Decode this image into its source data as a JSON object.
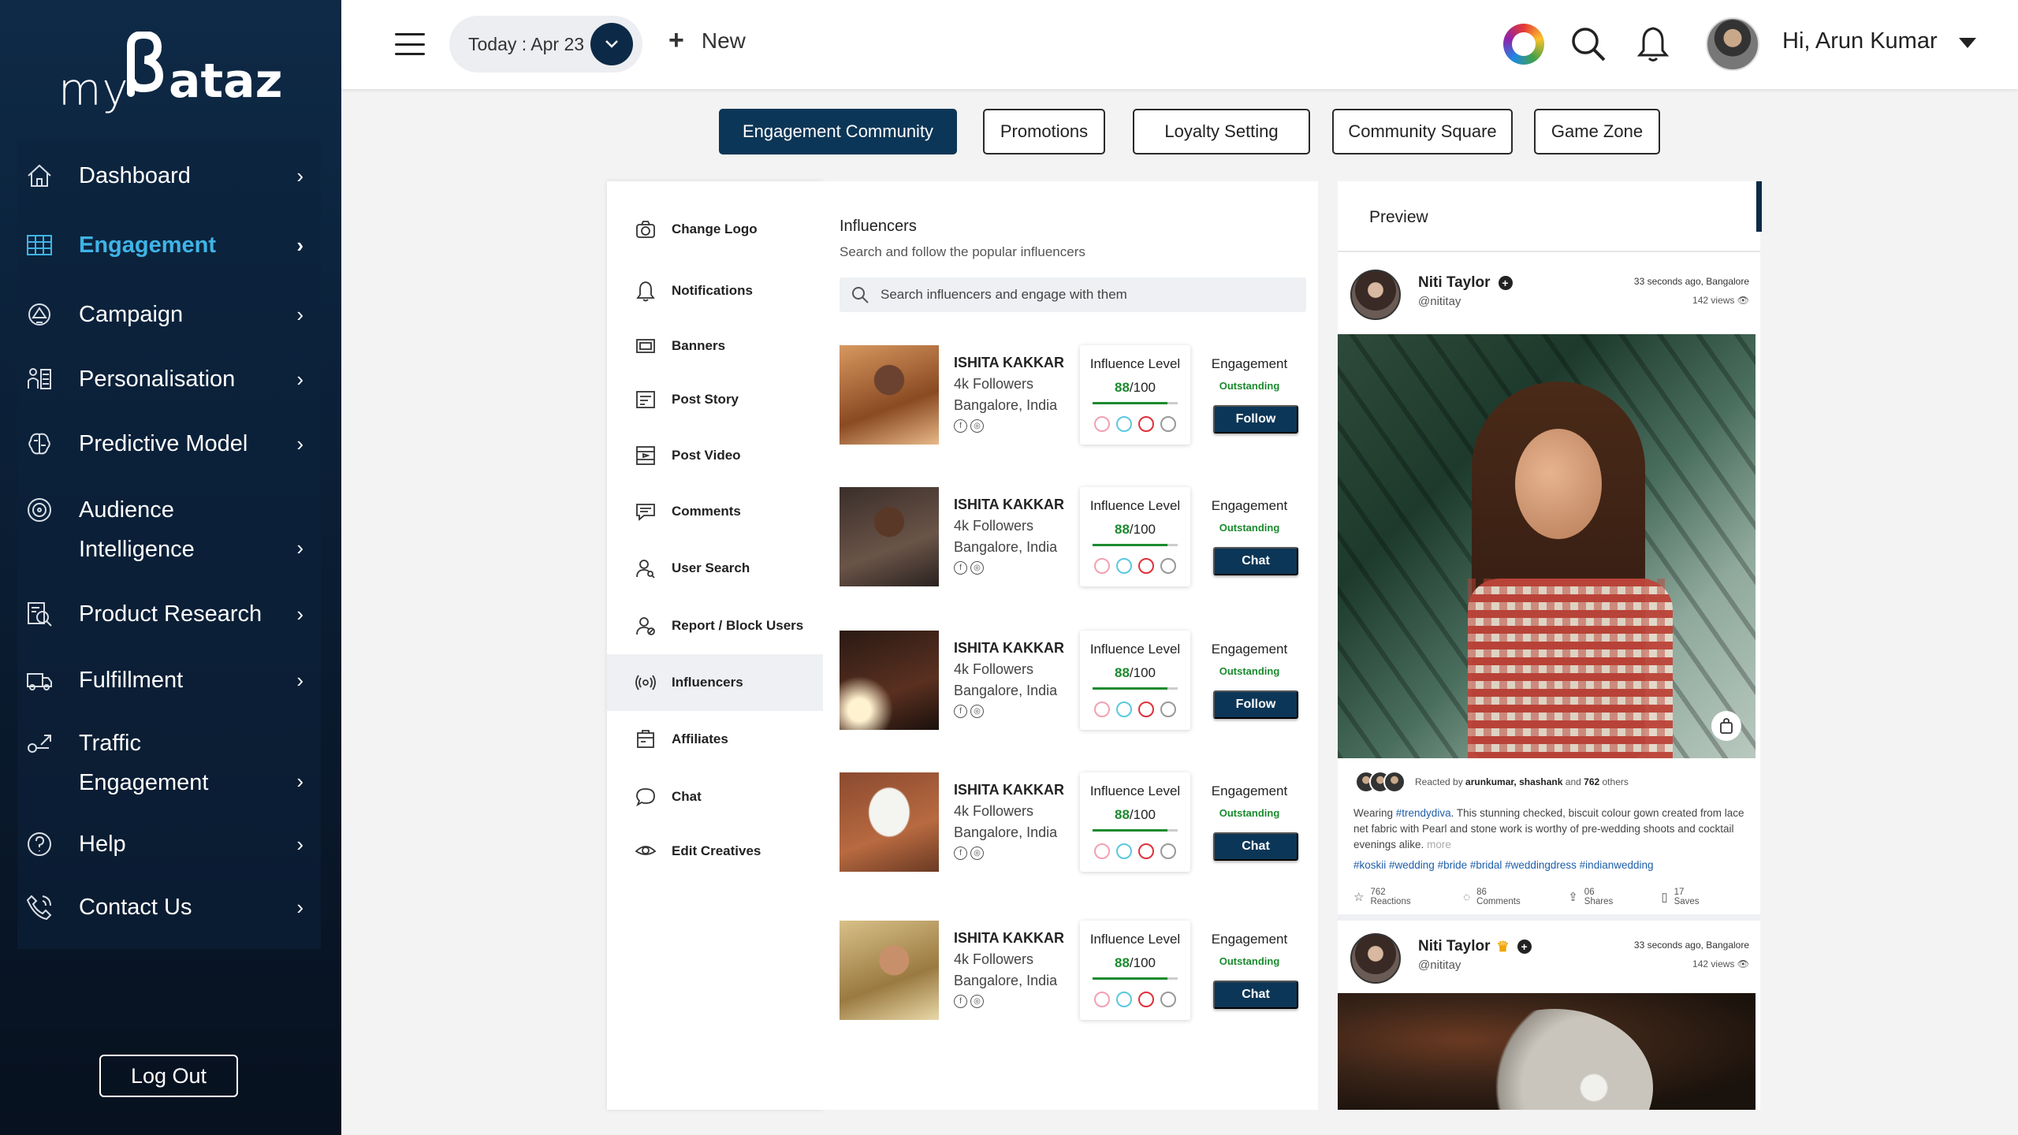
{
  "brand": {
    "logo_my": "my",
    "logo_ataz": "ataz"
  },
  "sidebar": {
    "items": [
      {
        "label": "Dashboard",
        "icon": "home-icon"
      },
      {
        "label": "Engagement",
        "icon": "grid-icon",
        "active": true
      },
      {
        "label": "Campaign",
        "icon": "campaign-icon"
      },
      {
        "label": "Personalisation",
        "icon": "personalisation-icon"
      },
      {
        "label": "Predictive Model",
        "icon": "brain-icon"
      },
      {
        "label": "Audience",
        "label2": "Intelligence",
        "icon": "target-icon"
      },
      {
        "label": "Product Research",
        "icon": "research-icon"
      },
      {
        "label": "Fulfillment",
        "icon": "truck-icon"
      },
      {
        "label": "Traffic",
        "label2": "Engagement",
        "icon": "traffic-icon"
      },
      {
        "label": "Help",
        "icon": "help-icon"
      },
      {
        "label": "Contact Us",
        "icon": "phone-icon"
      }
    ],
    "chevron": "›",
    "logout": "Log Out"
  },
  "header": {
    "date_label": "Today : Apr 23",
    "new_label": "New",
    "greeting": "Hi, Arun Kumar"
  },
  "tabs": [
    "Engagement Community",
    "Promotions",
    "Loyalty Setting",
    "Community Square",
    "Game Zone"
  ],
  "settings": [
    "Change Logo",
    "Notifications",
    "Banners",
    "Post Story",
    "Post Video",
    "Comments",
    "User Search",
    "Report / Block Users",
    "Influencers",
    "Affiliates",
    "Chat",
    "Edit Creatives"
  ],
  "influencers": {
    "title": "Influencers",
    "subtitle": "Search and follow the popular influencers",
    "search_placeholder": "Search influencers and engage with them",
    "influence_label": "Influence Level",
    "engagement_label": "Engagement",
    "list": [
      {
        "name": "ISHITA KAKKAR",
        "followers": "4k Followers",
        "location": "Bangalore, India",
        "score": "88",
        "max": "/100",
        "level": 0.88,
        "engagement": "Outstanding",
        "action": "Follow"
      },
      {
        "name": "ISHITA KAKKAR",
        "followers": "4k Followers",
        "location": "Bangalore, India",
        "score": "88",
        "max": "/100",
        "level": 0.88,
        "engagement": "Outstanding",
        "action": "Chat"
      },
      {
        "name": "ISHITA KAKKAR",
        "followers": "4k Followers",
        "location": "Bangalore, India",
        "score": "88",
        "max": "/100",
        "level": 0.88,
        "engagement": "Outstanding",
        "action": "Follow"
      },
      {
        "name": "ISHITA KAKKAR",
        "followers": "4k Followers",
        "location": "Bangalore, India",
        "score": "88",
        "max": "/100",
        "level": 0.88,
        "engagement": "Outstanding",
        "action": "Chat"
      },
      {
        "name": "ISHITA KAKKAR",
        "followers": "4k Followers",
        "location": "Bangalore, India",
        "score": "88",
        "max": "/100",
        "level": 0.88,
        "engagement": "Outstanding",
        "action": "Chat"
      }
    ]
  },
  "preview": {
    "title": "Preview",
    "posts": [
      {
        "name": "Niti Taylor",
        "handle": "@nititay",
        "time": "33 seconds ago, Bangalore",
        "views": "142 views",
        "reacted_prefix": "Reacted by ",
        "reacted_names": "arunkumar, shashank",
        "reacted_mid": " and ",
        "reacted_count": "762",
        "reacted_suffix": " others",
        "caption_prefix": "Wearing ",
        "caption_tag": "#trendydiva",
        "caption_text": ". This stunning checked, biscuit colour gown created from lace net fabric with Pearl and stone work is worthy of pre-wedding shoots and cocktail evenings alike.",
        "caption_more": "more",
        "hashtags": "#koskii #wedding #bride #bridal #weddingdress #indianwedding",
        "reactions": "762 Reactions",
        "comments": "86 Comments",
        "shares": "06 Shares",
        "saves": "17 Saves"
      },
      {
        "name": "Niti Taylor",
        "handle": "@nititay",
        "time": "33 seconds ago, Bangalore",
        "views": "142 views"
      }
    ]
  },
  "colors": {
    "sidebar_bg": "#0e2a47",
    "active_accent": "#3fb4e6",
    "primary_button": "#0c3657",
    "success": "#1b8a2e"
  }
}
